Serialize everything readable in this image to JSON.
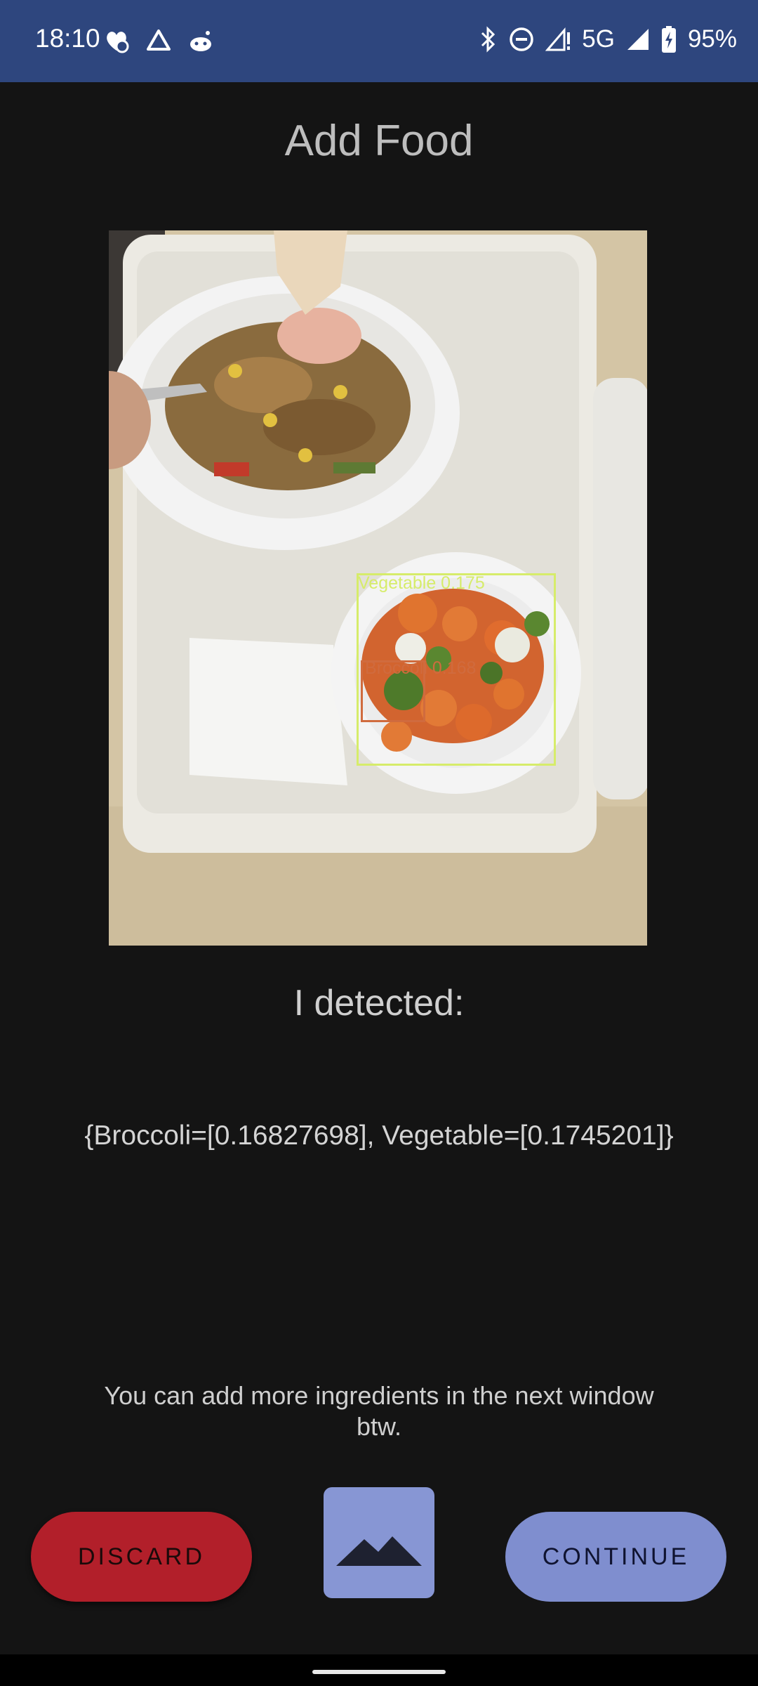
{
  "status_bar": {
    "time": "18:10",
    "left_icons": [
      "health-app-icon",
      "drive-icon",
      "reddit-icon"
    ],
    "right_icons": [
      "bluetooth-icon",
      "do-not-disturb-icon",
      "no-signal-icon",
      "signal-icon",
      "battery-charging-icon"
    ],
    "network": "5G",
    "battery": "95%",
    "background": "#2e467e"
  },
  "title": "Add Food",
  "photo": {
    "detections": [
      {
        "label": "Vegetable 0.175",
        "color": "#d6ec6a"
      },
      {
        "label": "Broccoli 0.168",
        "color": "#d06b3e"
      }
    ]
  },
  "detected_heading": "I detected:",
  "detected_values": "{Broccoli=[0.16827698], Vegetable=[0.1745201]}",
  "hint": "You can add more ingredients in the next window btw.",
  "buttons": {
    "discard": "DISCARD",
    "continue": "CONTINUE",
    "gallery_icon": "image-icon"
  },
  "colors": {
    "background": "#141414",
    "discard": "#b21f2a",
    "accent": "#7f8ecf"
  }
}
